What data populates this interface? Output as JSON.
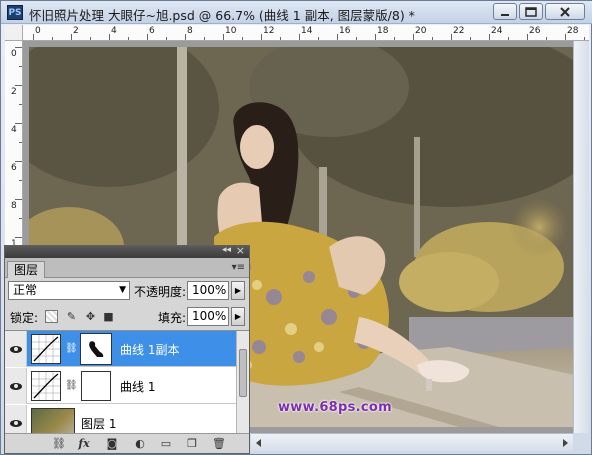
{
  "window": {
    "app_icon": "PS",
    "title": "怀旧照片处理 大眼仔~旭.psd @ 66.7% (曲线 1 副本, 图层蒙版/8) *",
    "buttons": {
      "minimize": "minimize-icon",
      "maximize": "maximize-icon",
      "close": "close-icon"
    }
  },
  "ruler": {
    "top_ticks": [
      "0",
      "2",
      "4",
      "6",
      "8",
      "10",
      "12",
      "14",
      "16",
      "18",
      "20",
      "22",
      "24",
      "26",
      "28"
    ],
    "left_ticks": [
      "0",
      "2",
      "4",
      "6",
      "8",
      "1"
    ]
  },
  "layers_panel": {
    "collapse_glyph": "◂◂",
    "close_glyph": "×",
    "tab_label": "图层",
    "menu_glyph": "▾≡",
    "blend_mode": "正常",
    "opacity_label": "不透明度:",
    "opacity_value": "100%",
    "lock_label": "锁定:",
    "fill_label": "填充:",
    "fill_value": "100%",
    "layers": [
      {
        "name": "曲线 1副本",
        "selected": true,
        "has_mask": true
      },
      {
        "name": "曲线 1",
        "selected": false,
        "has_mask": true
      },
      {
        "name": "图层 1",
        "selected": false,
        "has_mask": false
      }
    ],
    "bottom_icons": [
      "link-layers-icon",
      "fx-icon",
      "add-mask-icon",
      "adjustment-layer-icon",
      "group-icon",
      "new-layer-icon",
      "delete-icon"
    ]
  },
  "watermark": "www.68ps.com"
}
